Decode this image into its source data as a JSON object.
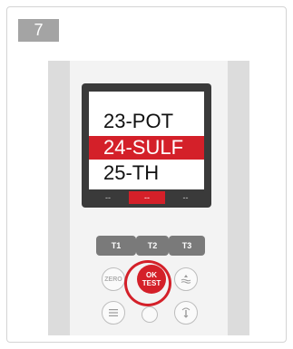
{
  "step": {
    "number": "7"
  },
  "screen": {
    "menu": [
      {
        "label": "23-POT",
        "selected": false
      },
      {
        "label": "24-SULF",
        "selected": true
      },
      {
        "label": "25-TH",
        "selected": false
      }
    ],
    "softkeys": [
      "--",
      "--",
      "--"
    ]
  },
  "keypad": {
    "t_keys": [
      {
        "label": "T1"
      },
      {
        "label": "T2"
      },
      {
        "label": "T3"
      }
    ],
    "zero_label": "ZERO",
    "ok_label_line1": "OK",
    "ok_label_line2": "TEST"
  },
  "icons": {
    "water": "water-waves-icon",
    "menu": "menu-lines-icon",
    "light": "light-icon"
  },
  "colors": {
    "accent": "#d42029",
    "panel": "#f3f3f3",
    "key": "#7a7a7a"
  }
}
